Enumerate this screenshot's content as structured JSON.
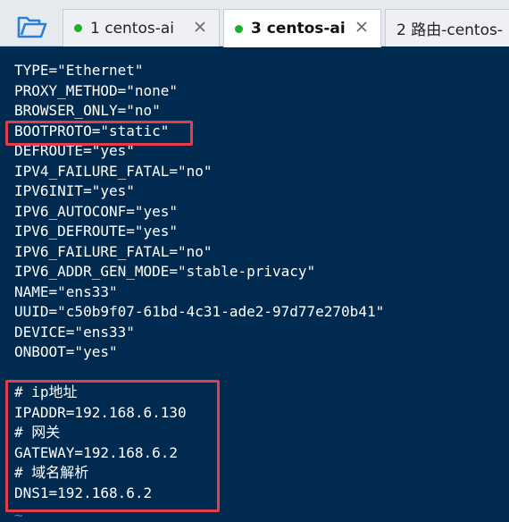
{
  "toolbar": {
    "open_folder_icon": "folder-open-icon"
  },
  "tabs": [
    {
      "label": "1 centos-ai",
      "active": false,
      "status_color": "#18b32a"
    },
    {
      "label": "3 centos-ai",
      "active": true,
      "status_color": "#18b32a"
    },
    {
      "label": "2 路由-centos-",
      "active": false
    }
  ],
  "terminal": {
    "lines": [
      "TYPE=\"Ethernet\"",
      "PROXY_METHOD=\"none\"",
      "BROWSER_ONLY=\"no\"",
      "BOOTPROTO=\"static\"",
      "DEFROUTE=\"yes\"",
      "IPV4_FAILURE_FATAL=\"no\"",
      "IPV6INIT=\"yes\"",
      "IPV6_AUTOCONF=\"yes\"",
      "IPV6_DEFROUTE=\"yes\"",
      "IPV6_FAILURE_FATAL=\"no\"",
      "IPV6_ADDR_GEN_MODE=\"stable-privacy\"",
      "NAME=\"ens33\"",
      "UUID=\"c50b9f07-61bd-4c31-ade2-97d77e270b41\"",
      "DEVICE=\"ens33\"",
      "ONBOOT=\"yes\"",
      "",
      "# ip地址",
      "IPADDR=192.168.6.130",
      "# 网关",
      "GATEWAY=192.168.6.2",
      "# 域名解析",
      "DNS1=192.168.6.2"
    ],
    "empty_line_marker": "~"
  },
  "colors": {
    "terminal_bg": "#002a50",
    "terminal_text": "#ffffff",
    "highlight_border": "#e53c4a",
    "status_dot": "#18b32a"
  }
}
